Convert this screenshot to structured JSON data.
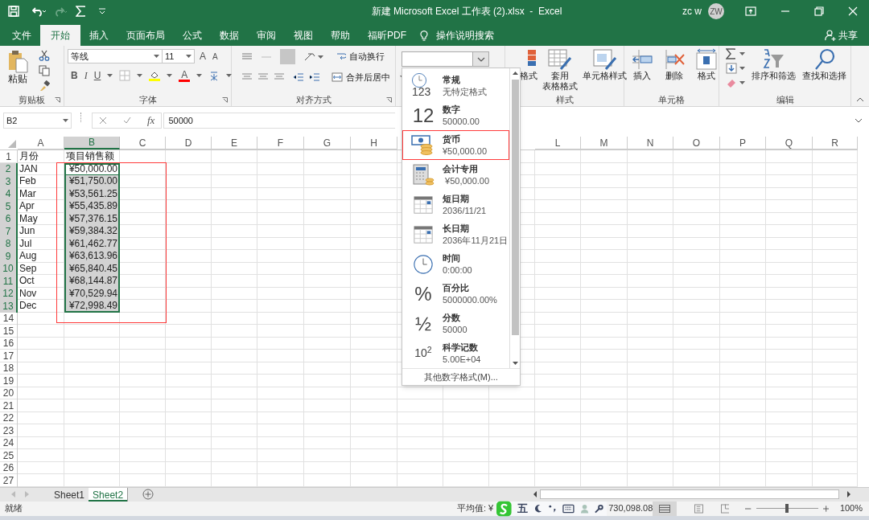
{
  "title_bar": {
    "title": "新建 Microsoft Excel 工作表 (2).xlsx  -  Excel",
    "user": "zc w",
    "avatar": "ZW"
  },
  "tabs": [
    {
      "label": "文件",
      "selected": false
    },
    {
      "label": "开始",
      "selected": true
    },
    {
      "label": "插入",
      "selected": false
    },
    {
      "label": "页面布局",
      "selected": false
    },
    {
      "label": "公式",
      "selected": false
    },
    {
      "label": "数据",
      "selected": false
    },
    {
      "label": "审阅",
      "selected": false
    },
    {
      "label": "视图",
      "selected": false
    },
    {
      "label": "帮助",
      "selected": false
    },
    {
      "label": "福昕PDF",
      "selected": false
    }
  ],
  "tell_me": "操作说明搜索",
  "share": "共享",
  "ribbon": {
    "clipboard": {
      "label": "剪贴板",
      "paste": "粘贴"
    },
    "font": {
      "label": "字体",
      "font_name": "等线",
      "font_size": "11",
      "grow": "A",
      "shrink": "A",
      "bold": "B",
      "italic": "I",
      "underline": "U",
      "font_color": "A"
    },
    "alignment": {
      "label": "对齐方式",
      "wrap": "自动换行",
      "merge": "合并后居中"
    },
    "styles": {
      "label": "样式",
      "conditional": "格式",
      "table": "套用",
      "table_2": "表格格式",
      "cell_styles": "单元格样式"
    },
    "cells": {
      "label": "单元格",
      "insert": "插入",
      "delete": "删除",
      "format": "格式"
    },
    "editing": {
      "label": "编辑",
      "sort": "排序和筛选",
      "find": "查找和选择"
    }
  },
  "formula_bar": {
    "name_box": "B2",
    "fx": "fx",
    "formula": "50000"
  },
  "column_headers": [
    {
      "letter": "A",
      "selected": false
    },
    {
      "letter": "B",
      "selected": true
    },
    {
      "letter": "C",
      "selected": false
    },
    {
      "letter": "D",
      "selected": false
    },
    {
      "letter": "E",
      "selected": false
    },
    {
      "letter": "F",
      "selected": false
    },
    {
      "letter": "G",
      "selected": false
    },
    {
      "letter": "H",
      "selected": false
    },
    {
      "letter": "L",
      "selected": false
    },
    {
      "letter": "M",
      "selected": false
    },
    {
      "letter": "N",
      "selected": false
    },
    {
      "letter": "O",
      "selected": false
    },
    {
      "letter": "P",
      "selected": false
    },
    {
      "letter": "Q",
      "selected": false
    },
    {
      "letter": "R",
      "selected": false
    }
  ],
  "rows": [
    {
      "number": "1",
      "cells": [
        {
          "text": "月份",
          "selected": false,
          "active": false
        },
        {
          "text": "项目销售额",
          "selected": false,
          "active": false
        }
      ]
    },
    {
      "number": "2",
      "cells": [
        {
          "text": "JAN",
          "selected": false,
          "active": false
        },
        {
          "text": "¥50,000.00",
          "selected": true,
          "active": true
        }
      ]
    },
    {
      "number": "3",
      "cells": [
        {
          "text": "Feb",
          "selected": false,
          "active": false
        },
        {
          "text": "¥51,750.00",
          "selected": true,
          "active": false
        }
      ]
    },
    {
      "number": "4",
      "cells": [
        {
          "text": "Mar",
          "selected": false,
          "active": false
        },
        {
          "text": "¥53,561.25",
          "selected": true,
          "active": false
        }
      ]
    },
    {
      "number": "5",
      "cells": [
        {
          "text": "Apr",
          "selected": false,
          "active": false
        },
        {
          "text": "¥55,435.89",
          "selected": true,
          "active": false
        }
      ]
    },
    {
      "number": "6",
      "cells": [
        {
          "text": "May",
          "selected": false,
          "active": false
        },
        {
          "text": "¥57,376.15",
          "selected": true,
          "active": false
        }
      ]
    },
    {
      "number": "7",
      "cells": [
        {
          "text": "Jun",
          "selected": false,
          "active": false
        },
        {
          "text": "¥59,384.32",
          "selected": true,
          "active": false
        }
      ]
    },
    {
      "number": "8",
      "cells": [
        {
          "text": "Jul",
          "selected": false,
          "active": false
        },
        {
          "text": "¥61,462.77",
          "selected": true,
          "active": false
        }
      ]
    },
    {
      "number": "9",
      "cells": [
        {
          "text": "Aug",
          "selected": false,
          "active": false
        },
        {
          "text": "¥63,613.96",
          "selected": true,
          "active": false
        }
      ]
    },
    {
      "number": "10",
      "cells": [
        {
          "text": "Sep",
          "selected": false,
          "active": false
        },
        {
          "text": "¥65,840.45",
          "selected": true,
          "active": false
        }
      ]
    },
    {
      "number": "11",
      "cells": [
        {
          "text": "Oct",
          "selected": false,
          "active": false
        },
        {
          "text": "¥68,144.87",
          "selected": true,
          "active": false
        }
      ]
    },
    {
      "number": "12",
      "cells": [
        {
          "text": "Nov",
          "selected": false,
          "active": false
        },
        {
          "text": "¥70,529.94",
          "selected": true,
          "active": false
        }
      ]
    },
    {
      "number": "13",
      "cells": [
        {
          "text": "Dec",
          "selected": false,
          "active": false
        },
        {
          "text": "¥72,998.49",
          "selected": true,
          "active": false
        }
      ]
    },
    {
      "number": "14"
    },
    {
      "number": "15"
    },
    {
      "number": "16"
    },
    {
      "number": "17"
    },
    {
      "number": "18"
    },
    {
      "number": "19"
    },
    {
      "number": "20"
    },
    {
      "number": "21"
    },
    {
      "number": "22"
    },
    {
      "number": "23"
    },
    {
      "number": "24"
    },
    {
      "number": "25"
    },
    {
      "number": "26"
    },
    {
      "number": "27"
    }
  ],
  "format_menu": {
    "items": [
      {
        "kind": "general",
        "icon_text": "123",
        "title": "常规",
        "example": "无特定格式",
        "annotated": false
      },
      {
        "kind": "number",
        "icon_text": "12",
        "title": "数字",
        "example": "50000.00",
        "annotated": false
      },
      {
        "kind": "currency",
        "title": "货币",
        "example": "¥50,000.00",
        "annotated": true
      },
      {
        "kind": "accounting",
        "title": "会计专用",
        "example": " ¥50,000.00",
        "annotated": false
      },
      {
        "kind": "short_date",
        "title": "短日期",
        "example": "2036/11/21",
        "annotated": false
      },
      {
        "kind": "long_date",
        "title": "长日期",
        "example": "2036年11月21日",
        "annotated": false
      },
      {
        "kind": "time",
        "title": "时间",
        "example": "0:00:00",
        "annotated": false
      },
      {
        "kind": "percent",
        "icon_text": "%",
        "title": "百分比",
        "example": "5000000.00%",
        "annotated": false
      },
      {
        "kind": "fraction",
        "icon_text": "½",
        "title": "分数",
        "example": "50000",
        "annotated": false
      },
      {
        "kind": "scientific",
        "icon_text": "10$^{2}$",
        "title": "科学记数",
        "example": "5.00E+04",
        "annotated": false
      }
    ],
    "more": "其他数字格式(M)..."
  },
  "sheet_tabs": [
    {
      "label": "Sheet1",
      "selected": false
    },
    {
      "label": "Sheet2",
      "selected": true
    }
  ],
  "status_bar": {
    "ready": "就绪",
    "average": "平均值: ¥",
    "ime_mode": "五",
    "sum": "730,098.08",
    "zoom_slider": {
      "level": 0.5
    },
    "zoom": "100%"
  }
}
